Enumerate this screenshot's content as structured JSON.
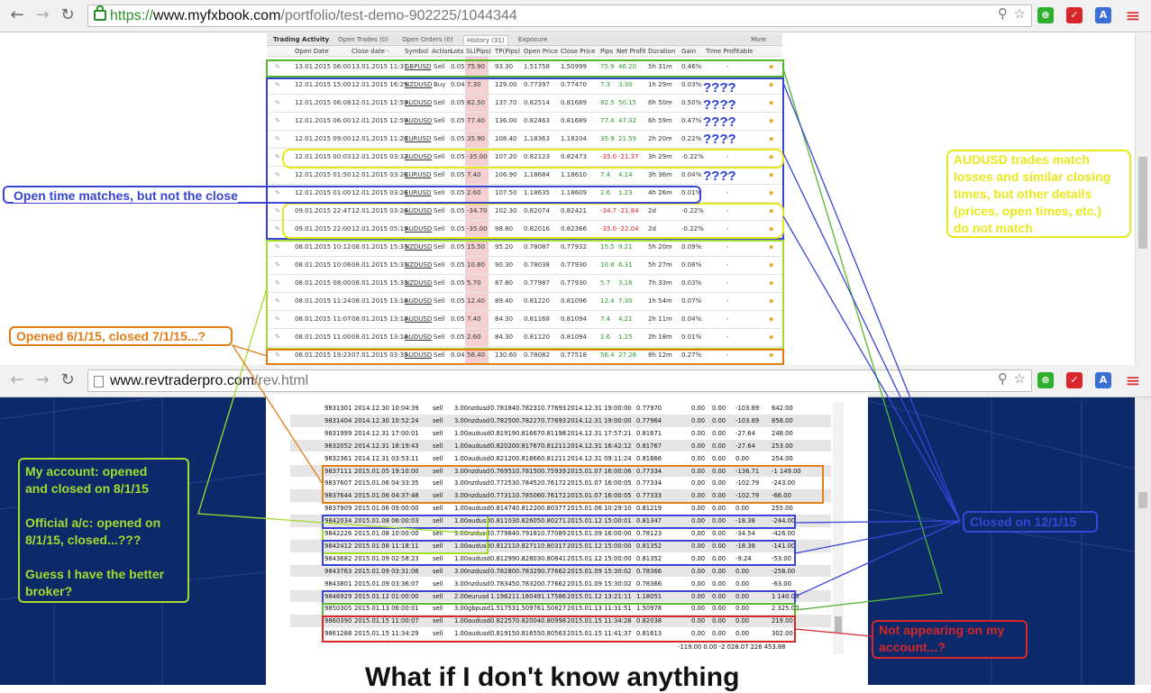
{
  "browser_top": {
    "url_secure": "https://",
    "url_host": "www.myfxbook.com",
    "url_path": "/portfolio/test-demo-902225/1044344"
  },
  "browser_bottom": {
    "url_host": "www.revtraderpro.com",
    "url_path": "/rev.html"
  },
  "colors": {
    "green": "#55b82e",
    "blue": "#3845d6",
    "yellow": "#e8e81a",
    "orange": "#e37d16",
    "red": "#d8262a",
    "lightgreen": "#a3dc2e"
  },
  "fx": {
    "tabs": [
      "Trading Activity",
      "Open Trades (0)",
      "Open Orders (0)",
      "History (31)",
      "Exposure"
    ],
    "more": "More",
    "headers": [
      "Open Date",
      "Close date -",
      "Symbol",
      "Action",
      "Lots",
      "SL(Pips)",
      "TP(Pips)",
      "Open Price",
      "Close Price",
      "Pips",
      "Net Profit",
      "Duration",
      "Gain",
      "Time Profitable"
    ],
    "rows": [
      [
        "13.01.2015 06:00",
        "13.01.2015 11:31",
        "GBPUSD",
        "Sell",
        "0.05",
        "75.90",
        "93.30",
        "1.51758",
        "1.50999",
        "75.9",
        "46.20",
        "5h 31m",
        "0.46%",
        "-"
      ],
      [
        "12.01.2015 15:00",
        "12.01.2015 16:29",
        "NZDUSD",
        "Buy",
        "0.04",
        "7.30",
        "129.00",
        "0.77397",
        "0.77470",
        "7.3",
        "3.30",
        "1h 29m",
        "0.03%",
        "-"
      ],
      [
        "12.01.2015 06:08",
        "12.01.2015 12:59",
        "AUDUSD",
        "Sell",
        "0.05",
        "82.50",
        "137.70",
        "0.82514",
        "0.81689",
        "82.5",
        "50.15",
        "6h 50m",
        "0.50%",
        "-"
      ],
      [
        "12.01.2015 06:00",
        "12.01.2015 12:59",
        "AUDUSD",
        "Sell",
        "0.05",
        "77.40",
        "136.00",
        "0.82463",
        "0.81689",
        "77.4",
        "47.02",
        "6h 59m",
        "0.47%",
        "-"
      ],
      [
        "12.01.2015 09:00",
        "12.01.2015 11:20",
        "EURUSD",
        "Sell",
        "0.05",
        "35.90",
        "108.40",
        "1.18363",
        "1.18204",
        "35.9",
        "21.59",
        "2h 20m",
        "0.22%",
        "-"
      ],
      [
        "12.01.2015 00:03",
        "12.01.2015 03:32",
        "AUDUSD",
        "Sell",
        "0.05",
        "-35.00",
        "107.20",
        "0.82123",
        "0.82473",
        "-35.0",
        "-21.37",
        "3h 29m",
        "-0.22%",
        "-"
      ],
      [
        "12.01.2015 01:50",
        "12.01.2015 03:26",
        "EURUSD",
        "Sell",
        "0.05",
        "7.40",
        "106.90",
        "1.18684",
        "1.18610",
        "7.4",
        "4.14",
        "3h 36m",
        "0.04%",
        "-"
      ],
      [
        "12.01.2015 01:00",
        "12.01.2015 03:26",
        "EURUSD",
        "Sell",
        "0.05",
        "2.60",
        "107.50",
        "1.18635",
        "1.18609",
        "2.6",
        "1.23",
        "4h 26m",
        "0.01%",
        "-"
      ],
      [
        "09.01.2015 22:47",
        "12.01.2015 03:26",
        "AUDUSD",
        "Sell",
        "0.05",
        "-34.70",
        "102.30",
        "0.82074",
        "0.82421",
        "-34.7",
        "-21.84",
        "2d",
        "-0.22%",
        "-"
      ],
      [
        "09.01.2015 22:00",
        "12.01.2015 05:19",
        "AUDUSD",
        "Sell",
        "0.05",
        "-35.00",
        "98.80",
        "0.82016",
        "0.82366",
        "-35.0",
        "-22.04",
        "2d",
        "-0.22%",
        "-"
      ],
      [
        "08.01.2015 10:12",
        "08.01.2015 15:33",
        "NZDUSD",
        "Sell",
        "0.05",
        "15.50",
        "95.20",
        "0.78087",
        "0.77932",
        "15.5",
        "9.21",
        "5h 20m",
        "0.09%",
        "-"
      ],
      [
        "08.01.2015 10:06",
        "08.01.2015 15:33",
        "NZDUSD",
        "Sell",
        "0.05",
        "10.80",
        "90.30",
        "0.78038",
        "0.77930",
        "10.8",
        "6.31",
        "5h 27m",
        "0.06%",
        "-"
      ],
      [
        "08.01.2015 08:00",
        "08.01.2015 15:33",
        "NZDUSD",
        "Sell",
        "0.05",
        "5.70",
        "87.80",
        "0.77987",
        "0.77930",
        "5.7",
        "3.16",
        "7h 33m",
        "0.03%",
        "-"
      ],
      [
        "08.01.2015 11:24",
        "08.01.2015 13:18",
        "AUDUSD",
        "Sell",
        "0.05",
        "12.40",
        "89.40",
        "0.81220",
        "0.81096",
        "12.4",
        "7.30",
        "1h 54m",
        "0.07%",
        "-"
      ],
      [
        "08.01.2015 11:07",
        "08.01.2015 13:18",
        "AUDUSD",
        "Sell",
        "0.05",
        "7.40",
        "84.30",
        "0.81168",
        "0.81094",
        "7.4",
        "4.21",
        "2h 11m",
        "0.04%",
        "-"
      ],
      [
        "08.01.2015 11:00",
        "08.01.2015 13:18",
        "AUDUSD",
        "Sell",
        "0.05",
        "2.60",
        "84.30",
        "0.81120",
        "0.81094",
        "2.6",
        "1.25",
        "2h 18m",
        "0.01%",
        "-"
      ],
      [
        "06.01.2015 19:23",
        "07.01.2015 03:35",
        "AUDUSD",
        "Sell",
        "0.04",
        "56.40",
        "130.60",
        "0.78082",
        "0.77518",
        "56.4",
        "27.28",
        "8h 12m",
        "0.27%",
        "-"
      ]
    ]
  },
  "rv": {
    "rows": [
      [
        "9831301",
        "2014.12.30 10:04:39",
        "sell",
        "3.00",
        "nzdusd",
        "0.78184",
        "0.78231",
        "0.77693",
        "2014.12.31 19:00:00",
        "0.77970",
        "0.00",
        "0.00",
        "-103.69",
        "642.00"
      ],
      [
        "9831404",
        "2014.12.30 10:52:24",
        "sell",
        "3.00",
        "nzdusd",
        "0.78250",
        "0.78227",
        "0.77693",
        "2014.12.31 19:00:00",
        "0.77964",
        "0.00",
        "0.00",
        "-103.69",
        "858.00"
      ],
      [
        "9831999",
        "2014.12.31 17:00:01",
        "sell",
        "1.00",
        "audusd",
        "0.81919",
        "0.81667",
        "0.81198",
        "2014.12.31 17:57:21",
        "0.81671",
        "0.00",
        "0.00",
        "-27.64",
        "248.00"
      ],
      [
        "9832052",
        "2014.12.31 18:19:43",
        "sell",
        "1.00",
        "audusd",
        "0.82020",
        "0.81767",
        "0.81211",
        "2014.12.31 16:42:12",
        "0.81767",
        "0.00",
        "0.00",
        "-27.64",
        "253.00"
      ],
      [
        "9832361",
        "2014.12.31 03:53:11",
        "sell",
        "1.00",
        "audusd",
        "0.82120",
        "0.81866",
        "0.81211",
        "2014.12.31 09:11:24",
        "0.81866",
        "0.00",
        "0.00",
        "0.00",
        "254.00"
      ],
      [
        "9837111",
        "2015.01.05 19:10:00",
        "sell",
        "3.00",
        "nzdusd",
        "0.76951",
        "0.78150",
        "0.75939",
        "2015.01.07 16:00:06",
        "0.77334",
        "0.00",
        "0.00",
        "-136.71",
        "-1 149.00"
      ],
      [
        "9837607",
        "2015.01.06 04:33:35",
        "sell",
        "3.00",
        "nzdusd",
        "0.77253",
        "0.78452",
        "0.76172",
        "2015.01.07 16:00:05",
        "0.77334",
        "0.00",
        "0.00",
        "-102.79",
        "-243.00"
      ],
      [
        "9837644",
        "2015.01.06 04:37:48",
        "sell",
        "3.00",
        "nzdusd",
        "0.77311",
        "0.78506",
        "0.76172",
        "2015.01.07 16:00:05",
        "0.77333",
        "0.00",
        "0.00",
        "-102.79",
        "-66.00"
      ],
      [
        "9837909",
        "2015.01.06 09:00:00",
        "sell",
        "1.00",
        "audusd",
        "0.81474",
        "0.81220",
        "0.80377",
        "2015.01.06 10:29:10",
        "0.81219",
        "0.00",
        "0.00",
        "0.00",
        "255.00"
      ],
      [
        "9842034",
        "2015.01.08 06:00:03",
        "sell",
        "1.00",
        "audusd",
        "0.81103",
        "0.82605",
        "0.80271",
        "2015.01.12 15:00:01",
        "0.81347",
        "0.00",
        "0.00",
        "-18.38",
        "-244.00"
      ],
      [
        "9842226",
        "2015.01.08 10:00:00",
        "sell",
        "3.00",
        "nzdusd",
        "0.77984",
        "0.79181",
        "0.77089",
        "2015.01.09 16:00:00",
        "0.78123",
        "0.00",
        "0.00",
        "-34.54",
        "-426.00"
      ],
      [
        "9842412",
        "2015.01.08 11:18:11",
        "sell",
        "1.00",
        "audusd",
        "0.81211",
        "0.82711",
        "0.80317",
        "2015.01.12 15:00:00",
        "0.81352",
        "0.00",
        "0.00",
        "-18.38",
        "-141.00"
      ],
      [
        "9843682",
        "2015.01.09 02:58:23",
        "sell",
        "1.00",
        "audusd",
        "0.81299",
        "0.82803",
        "0.80841",
        "2015.01.12 15:00:00",
        "0.81352",
        "0.00",
        "0.00",
        "-9.24",
        "-53.00"
      ],
      [
        "9843763",
        "2015.01.09 03:31:06",
        "sell",
        "3.00",
        "nzdusd",
        "0.78280",
        "0.78329",
        "0.77662",
        "2015.01.09 15:30:02",
        "0.78366",
        "0.00",
        "0.00",
        "0.00",
        "-258.00"
      ],
      [
        "9843801",
        "2015.01.09 03:36:07",
        "sell",
        "3.00",
        "nzdusd",
        "0.78345",
        "0.78320",
        "0.77662",
        "2015.01.09 15:30:02",
        "0.78366",
        "0.00",
        "0.00",
        "0.00",
        "-63.00"
      ],
      [
        "9846929",
        "2015.01.12 01:00:00",
        "sell",
        "2.00",
        "eurusd",
        "1.19621",
        "1.18049",
        "1.17586",
        "2015.01.12 13:21:11",
        "1.18051",
        "0.00",
        "0.00",
        "0.00",
        "1 140.00"
      ],
      [
        "9850305",
        "2015.01.13 06:00:01",
        "sell",
        "3.00",
        "gbpusd",
        "1.51753",
        "1.50976",
        "1.50827",
        "2015.01.13 11:31:51",
        "1.50978",
        "0.00",
        "0.00",
        "0.00",
        "2 325.00"
      ],
      [
        "9860390",
        "2015.01.15 11:00:07",
        "sell",
        "1.00",
        "audusd",
        "0.82257",
        "0.82004",
        "0.80998",
        "2015.01.15 11:34:28",
        "0.82038",
        "0.00",
        "0.00",
        "0.00",
        "219.00"
      ],
      [
        "9861288",
        "2015.01.15 11:34:29",
        "sell",
        "1.00",
        "audusd",
        "0.81915",
        "0.81655",
        "0.80563",
        "2015.01.15 11:41:37",
        "0.81613",
        "0.00",
        "0.00",
        "0.00",
        "302.00"
      ]
    ],
    "totals": "-119.00   0.00 -2 028.07  226 453.88",
    "bg_heading": "What if I don't know anything"
  },
  "annotations": {
    "qmarks": "????",
    "open_time": "Open time matches, but not the close",
    "audusd": [
      "AUDUSD trades match",
      "losses and similar closing",
      "times, but other details",
      "(prices, open times, etc.)",
      "do not match"
    ],
    "opened": "Opened 6/1/15, closed 7/1/15...?",
    "my_account": [
      "My account: opened",
      "and closed on 8/1/15",
      "",
      "Official a/c: opened on",
      "8/1/15, closed...???",
      "",
      "Guess I have the better",
      "broker?"
    ],
    "closed": "Closed on 12/1/15",
    "not_appearing": [
      "Not appearing on my",
      "account...?"
    ]
  }
}
